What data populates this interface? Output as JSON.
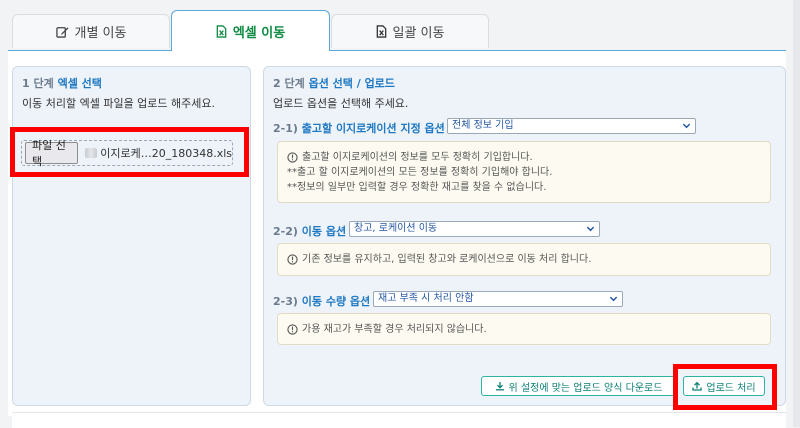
{
  "tabs": [
    {
      "label": "개별 이동",
      "icon": "edit-icon",
      "active": false
    },
    {
      "label": "엑셀 이동",
      "icon": "excel-file-icon",
      "active": true
    },
    {
      "label": "일괄 이동",
      "icon": "excel-file-icon",
      "active": false
    }
  ],
  "step1": {
    "prefix": "1 단계",
    "title": "엑셀 선택",
    "description": "이동 처리할 엑셀 파일을 업로드 해주세요.",
    "file_button": "파일 선택",
    "file_name": "이지로케…20_180348.xls"
  },
  "step2": {
    "prefix": "2 단계",
    "title": "옵션 선택 / 업로드",
    "description": "업로드 옵션을 선택해 주세요.",
    "options": [
      {
        "num": "2-1)",
        "label": "출고할 이지로케이션 지정 옵션 :",
        "selected": "전체 정보 기입",
        "notes": [
          "출고할 이지로케이션의 정보를 모두 정확히 기입합니다.",
          "**출고 할 이지로케이션의 모든 정보를 정확히 기입해야 합니다.",
          "**정보의 일부만 입력할 경우 정확한 재고를 찾을 수 없습니다."
        ]
      },
      {
        "num": "2-2)",
        "label": "이동 옵션 :",
        "selected": "창고, 로케이션 이동",
        "notes": [
          "기존 정보를 유지하고, 입력된 창고와 로케이션으로 이동 처리 합니다."
        ]
      },
      {
        "num": "2-3)",
        "label": "이동 수량 옵션 :",
        "selected": "재고 부족 시 처리 안함",
        "notes": [
          "가용 재고가 부족할 경우 처리되지 않습니다."
        ]
      }
    ],
    "download_button": "위 설정에 맞는 업로드 양식 다운로드",
    "upload_button": "업로드 처리"
  },
  "colors": {
    "accent": "#1e78c2",
    "excel_green": "#0f8b44",
    "button_teal": "#2eb3a3",
    "highlight_red": "#ff0000"
  }
}
